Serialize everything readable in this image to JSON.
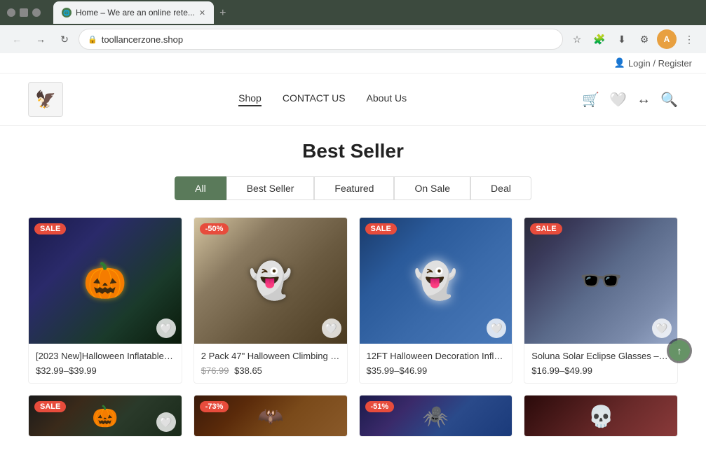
{
  "browser": {
    "tab_title": "Home – We are an online rete...",
    "tab_favicon": "🔒",
    "address": "toollancerzone.shop",
    "new_tab_label": "+"
  },
  "site": {
    "login_label": "Login / Register",
    "logo_emoji": "🦅",
    "nav": [
      {
        "label": "Shop",
        "active": true
      },
      {
        "label": "CONTACT US",
        "active": false
      },
      {
        "label": "About Us",
        "active": false
      }
    ],
    "section_title": "Best Seller",
    "filters": [
      {
        "label": "All",
        "active": true
      },
      {
        "label": "Best Seller",
        "active": false
      },
      {
        "label": "Featured",
        "active": false
      },
      {
        "label": "On Sale",
        "active": false
      },
      {
        "label": "Deal",
        "active": false
      }
    ],
    "products": [
      {
        "name": "[2023 New]Halloween Inflatables ...",
        "price_range": "$32.99–$39.99",
        "badge": "SALE",
        "badge_type": "sale",
        "img_class": "img-halloween1",
        "emoji": "🎃"
      },
      {
        "name": "2 Pack 47\" Halloween Climbing Zo...",
        "price_original": "$76.99",
        "price_sale": "$38.65",
        "badge": "-50%",
        "badge_type": "discount",
        "img_class": "img-halloween2",
        "emoji": "👻"
      },
      {
        "name": "12FT Halloween Decoration Inflata...",
        "price_range": "$35.99–$46.99",
        "badge": "SALE",
        "badge_type": "sale",
        "img_class": "img-halloween3",
        "emoji": "👻"
      },
      {
        "name": "Soluna Solar Eclipse Glasses – CE a...",
        "price_range": "$16.99–$49.99",
        "badge": "SALE",
        "badge_type": "sale",
        "img_class": "img-eclipse",
        "emoji": "🕶️"
      }
    ],
    "products_row2": [
      {
        "badge": "SALE",
        "badge_type": "sale",
        "img_class": "img-halloween5",
        "emoji": "🎃"
      },
      {
        "badge": "-73%",
        "badge_type": "discount",
        "img_class": "img-halloween6",
        "emoji": "🦇"
      },
      {
        "badge": "-51%",
        "badge_type": "discount",
        "img_class": "img-halloween7",
        "emoji": "🕷️"
      },
      {
        "img_class": "img-halloween8",
        "emoji": "💀"
      }
    ]
  }
}
